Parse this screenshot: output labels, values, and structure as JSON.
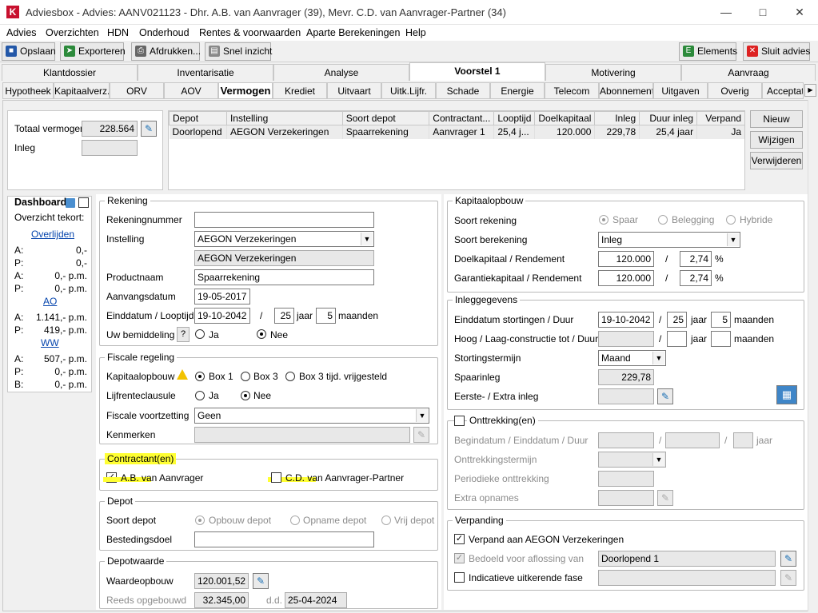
{
  "window": {
    "title": "Adviesbox - Advies: AANV021123 - Dhr. A.B. van Aanvrager (39), Mevr. C.D. van Aanvrager-Partner (34)",
    "logo": "K"
  },
  "menu": [
    "Advies",
    "Overzichten",
    "HDN",
    "Onderhoud",
    "Rentes & voorwaarden",
    "Aparte Berekeningen",
    "Help"
  ],
  "toolbar": {
    "save": "Opslaan",
    "export": "Exporteren",
    "print": "Afdrukken...",
    "quick": "Snel inzicht",
    "elements": "Elements",
    "close": "Sluit advies"
  },
  "tabs1": [
    "Klantdossier",
    "Inventarisatie",
    "Analyse",
    "Voorstel 1",
    "Motivering",
    "Aanvraag"
  ],
  "tabs2": [
    "Hypotheek",
    "Kapitaalverz.",
    "ORV",
    "AOV",
    "Vermogen",
    "Krediet",
    "Uitvaart",
    "Uitk.Lijfr.",
    "Schade",
    "Energie",
    "Telecom",
    "Abonnement",
    "Uitgaven",
    "Overig",
    "Acceptatie"
  ],
  "summary": {
    "total_label": "Totaal vermogen",
    "total_value": "228.564",
    "inleg_label": "Inleg",
    "inleg_value": ""
  },
  "grid": {
    "headers": [
      "Depot",
      "Instelling",
      "Soort depot",
      "Contractant...",
      "Looptijd",
      "Doelkapitaal",
      "Inleg",
      "Duur inleg",
      "Verpand"
    ],
    "rows": [
      [
        "Doorlopend",
        "AEGON Verzekeringen",
        "Spaarrekening",
        "Aanvrager 1",
        "25,4 j...",
        "120.000",
        "229,78",
        "25,4 jaar",
        "Ja"
      ]
    ]
  },
  "grid_buttons": {
    "new": "Nieuw",
    "edit": "Wijzigen",
    "delete": "Verwijderen"
  },
  "dashboard": {
    "title": "Dashboard",
    "overview": "Overzicht tekort:",
    "sections": [
      {
        "link": "Overlijden",
        "rows": [
          [
            "A:",
            "0,-"
          ],
          [
            "P:",
            "0,-"
          ],
          [
            "A:",
            "0,- p.m."
          ],
          [
            "P:",
            "0,- p.m."
          ]
        ]
      },
      {
        "link": "AO",
        "rows": [
          [
            "A:",
            "1.141,- p.m."
          ],
          [
            "P:",
            "419,- p.m."
          ]
        ]
      },
      {
        "link": "WW",
        "rows": [
          [
            "A:",
            "507,- p.m."
          ],
          [
            "P:",
            "0,- p.m."
          ],
          [
            "B:",
            "0,- p.m."
          ]
        ]
      }
    ]
  },
  "rekening": {
    "title": "Rekening",
    "nr_label": "Rekeningnummer",
    "nr_value": "",
    "instelling_label": "Instelling",
    "instelling_value": "AEGON Verzekeringen",
    "instelling_display": "AEGON Verzekeringen",
    "product_label": "Productnaam",
    "product_value": "Spaarrekening",
    "aanvang_label": "Aanvangsdatum",
    "aanvang_value": "19-05-2017",
    "eind_label": "Einddatum / Looptijd",
    "eind_value": "19-10-2042",
    "slash": "/",
    "jaar_value": "25",
    "jaar": "jaar",
    "maanden_value": "5",
    "maanden": "maanden",
    "bemid_label": "Uw bemiddeling",
    "help": "?",
    "ja": "Ja",
    "nee": "Nee"
  },
  "fiscaal": {
    "title": "Fiscale regeling",
    "kap_label": "Kapitaalopbouw",
    "box1": "Box 1",
    "box3": "Box 3",
    "box3v": "Box 3 tijd. vrijgesteld",
    "lijf_label": "Lijfrenteclausule",
    "ja": "Ja",
    "nee": "Nee",
    "voortz_label": "Fiscale voortzetting",
    "voortz_value": "Geen",
    "kenmerken_label": "Kenmerken",
    "kenmerken_value": ""
  },
  "contractant": {
    "title": "Contractant(en)",
    "a1": "A.B. van Aanvrager",
    "a2": "C.D. van Aanvrager-Partner"
  },
  "depot": {
    "title": "Depot",
    "soort_label": "Soort depot",
    "opbouw": "Opbouw depot",
    "opname": "Opname depot",
    "vrij": "Vrij depot",
    "doel_label": "Bestedingsdoel",
    "doel_value": ""
  },
  "depotwaarde": {
    "title": "Depotwaarde",
    "waarde_label": "Waardeopbouw",
    "waarde_value": "120.001,52",
    "reeds_label": "Reeds opgebouwd",
    "reeds_value": "32.345,00",
    "dd": "d.d.",
    "dd_value": "25-04-2024"
  },
  "kapitaal": {
    "title": "Kapitaalopbouw",
    "soort_label": "Soort rekening",
    "spaar": "Spaar",
    "beleg": "Belegging",
    "hybride": "Hybride",
    "ber_label": "Soort berekening",
    "ber_value": "Inleg",
    "doel_label": "Doelkapitaal / Rendement",
    "doel_value": "120.000",
    "doel_pct": "2,74",
    "gar_label": "Garantiekapitaal / Rendement",
    "gar_value": "120.000",
    "gar_pct": "2,74",
    "slash": "/",
    "pct": "%"
  },
  "inleg": {
    "title": "Inleggegevens",
    "eind_label": "Einddatum stortingen / Duur",
    "eind_value": "19-10-2042",
    "jaar_value": "25",
    "maand_value": "5",
    "jaar": "jaar",
    "maanden": "maanden",
    "hoog_label": "Hoog / Laag-constructie tot / Duur",
    "term_label": "Stortingstermijn",
    "term_value": "Maand",
    "spaar_label": "Spaarinleg",
    "spaar_value": "229,78",
    "extra_label": "Eerste- / Extra inleg",
    "slash": "/"
  },
  "onttrekking": {
    "title": "Onttrekking(en)",
    "begin_label": "Begindatum / Einddatum / Duur",
    "term_label": "Onttrekkingstermijn",
    "per_label": "Periodieke onttrekking",
    "extra_label": "Extra opnames",
    "jaar": "jaar",
    "slash": "/"
  },
  "verpanding": {
    "title": "Verpanding",
    "verpand_label": "Verpand aan AEGON Verzekeringen",
    "bedoeld_label": "Bedoeld voor aflossing van",
    "bedoeld_value": "Doorlopend 1",
    "indic_label": "Indicatieve uitkerende fase"
  }
}
